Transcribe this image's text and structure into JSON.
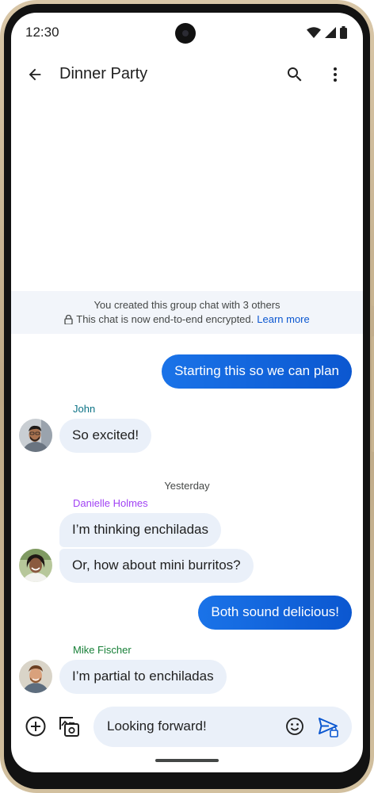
{
  "status_bar": {
    "time": "12:30"
  },
  "app_bar": {
    "title": "Dinner Party"
  },
  "info_banner": {
    "line1": "You created this group chat with 3 others",
    "line2": "This chat is now end-to-end encrypted.",
    "link": "Learn more"
  },
  "messages": [
    {
      "direction": "outgoing",
      "text": "Starting this so we can plan"
    },
    {
      "direction": "incoming",
      "sender": "John",
      "text": "So excited!"
    },
    {
      "type": "date_divider",
      "text": "Yesterday"
    },
    {
      "direction": "incoming",
      "sender": "Danielle Holmes",
      "text": "I’m thinking enchiladas"
    },
    {
      "direction": "incoming",
      "sender": "Danielle Holmes",
      "text": "Or, how about mini burritos?"
    },
    {
      "direction": "outgoing",
      "text": "Both sound delicious!"
    },
    {
      "direction": "incoming",
      "sender": "Mike Fischer",
      "text": "I’m partial to enchiladas"
    }
  ],
  "compose": {
    "value": "Looking forward!"
  },
  "colors": {
    "outgoing_bubble": "#0b57d0",
    "incoming_bubble": "#eaf0f9",
    "john": "#0b7285",
    "danielle": "#a142f4",
    "mike": "#188038",
    "link": "#0b57d0"
  },
  "icons": {
    "back": "arrow-left-icon",
    "search": "search-icon",
    "more": "more-vert-icon",
    "lock": "lock-icon",
    "add": "add-circle-icon",
    "gallery": "gallery-icon",
    "emoji": "emoji-icon",
    "send": "send-encrypted-icon"
  }
}
